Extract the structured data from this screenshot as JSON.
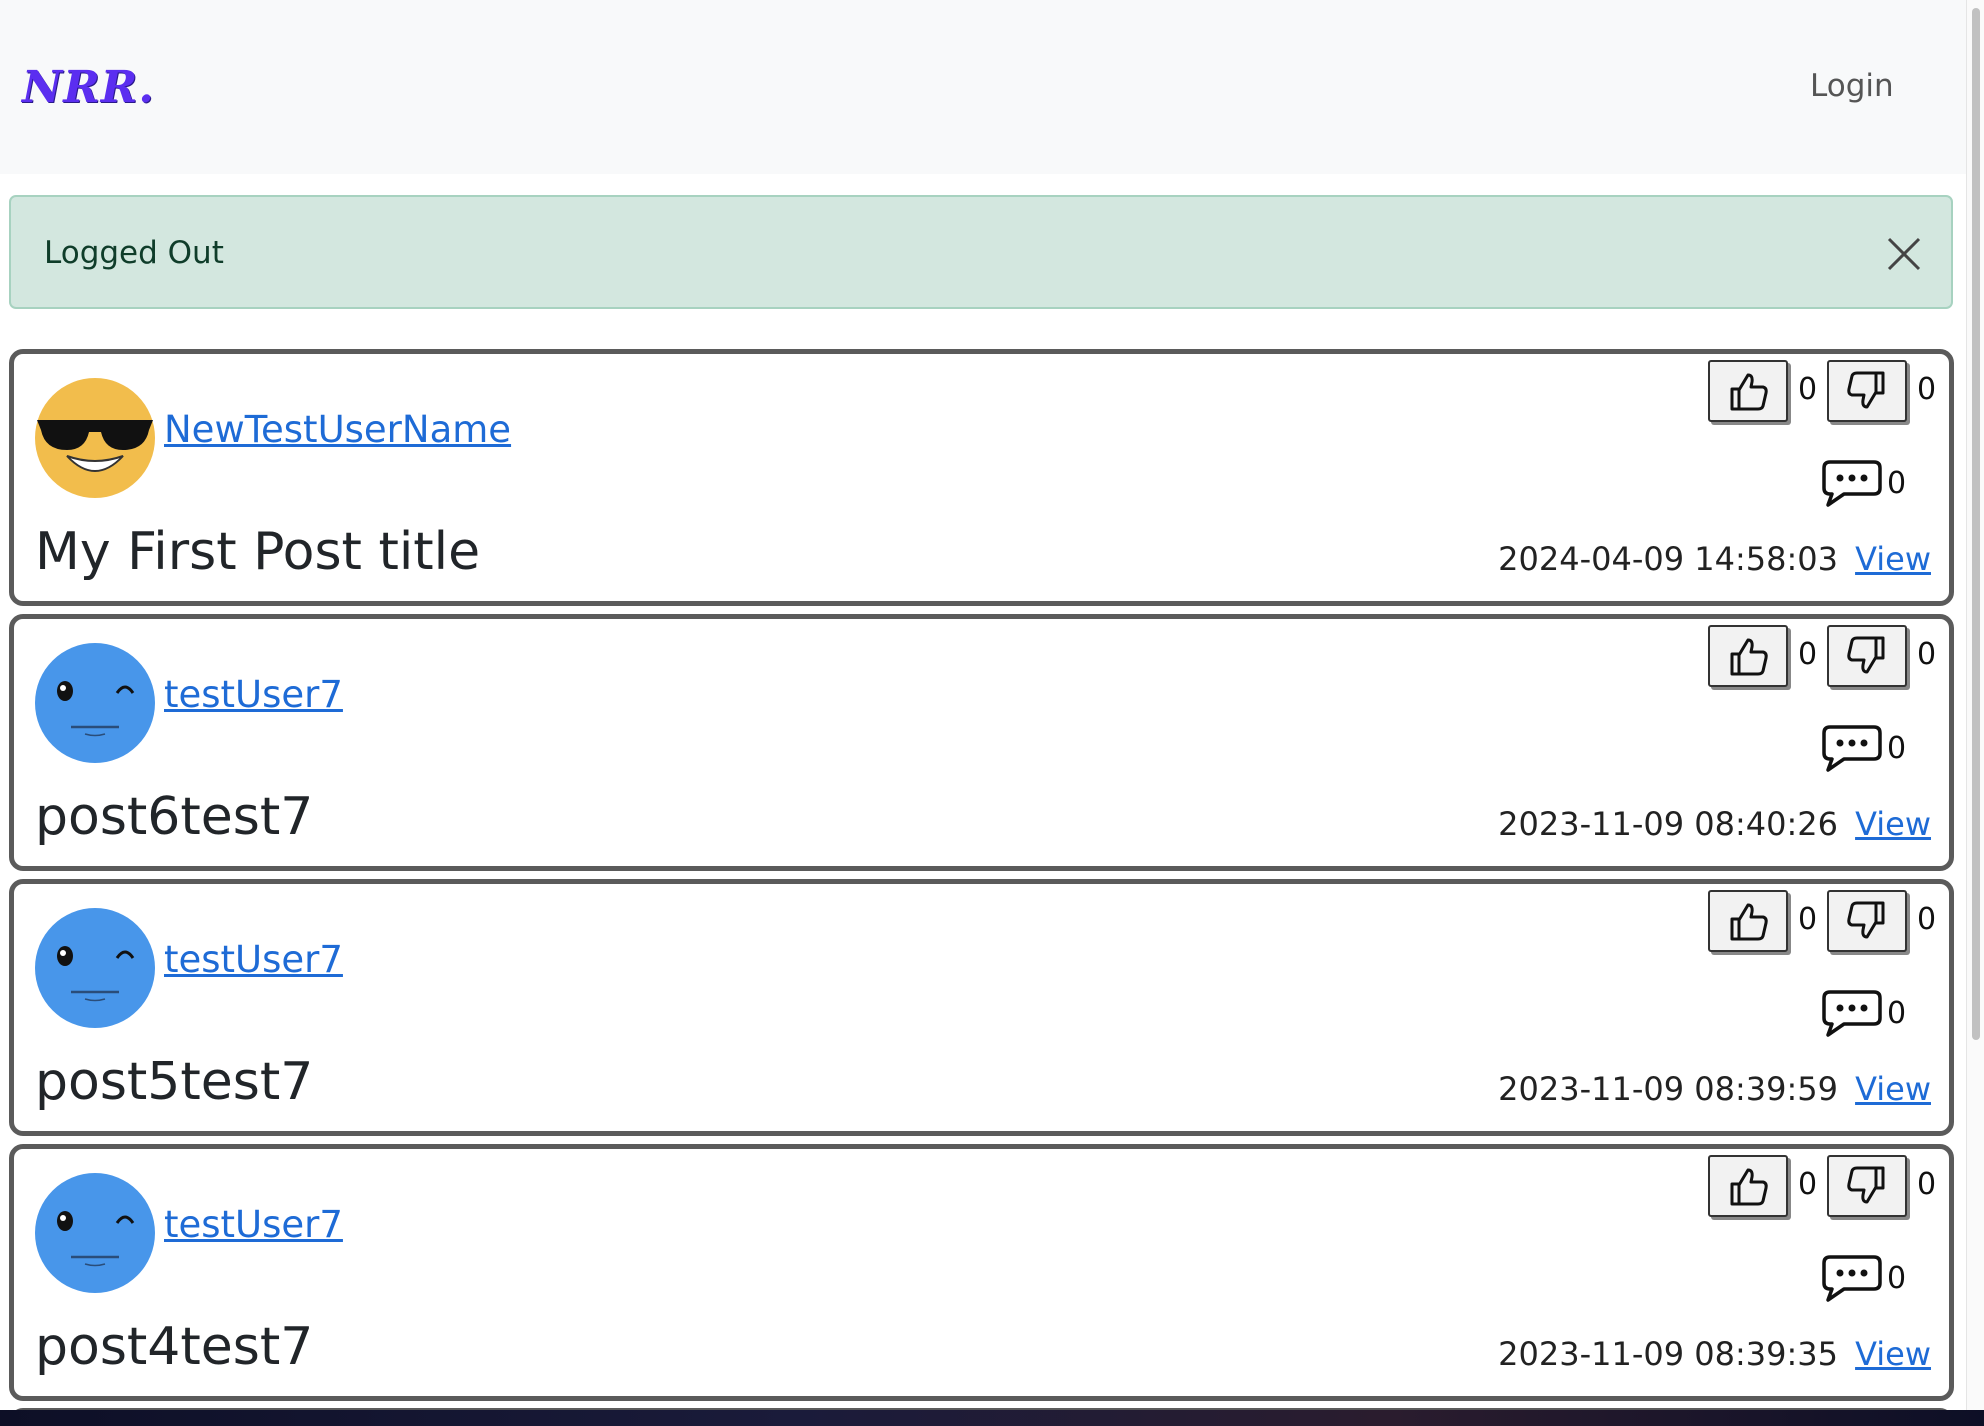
{
  "navbar": {
    "brand": "NRR.",
    "login_label": "Login"
  },
  "alert": {
    "message": "Logged Out"
  },
  "posts": [
    {
      "author": "NewTestUserName",
      "avatar": "sunglasses-emoji-icon",
      "title": "My First Post title",
      "likes": "0",
      "dislikes": "0",
      "comments": "0",
      "date": "2024-04-09 14:58:03",
      "view_label": "View"
    },
    {
      "author": "testUser7",
      "avatar": "winking-blue-face-icon",
      "title": "post6test7",
      "likes": "0",
      "dislikes": "0",
      "comments": "0",
      "date": "2023-11-09 08:40:26",
      "view_label": "View"
    },
    {
      "author": "testUser7",
      "avatar": "winking-blue-face-icon",
      "title": "post5test7",
      "likes": "0",
      "dislikes": "0",
      "comments": "0",
      "date": "2023-11-09 08:39:59",
      "view_label": "View"
    },
    {
      "author": "testUser7",
      "avatar": "winking-blue-face-icon",
      "title": "post4test7",
      "likes": "0",
      "dislikes": "0",
      "comments": "0",
      "date": "2023-11-09 08:39:35",
      "view_label": "View"
    }
  ],
  "colors": {
    "brand": "#5b2ef0",
    "link": "#1e6bd6",
    "alert_bg": "#d3e7df",
    "card_border": "#5b5b5b"
  }
}
